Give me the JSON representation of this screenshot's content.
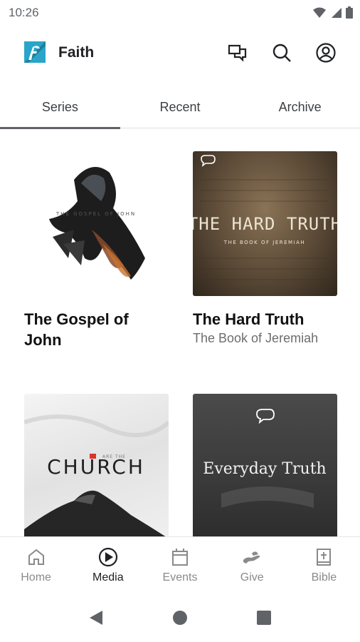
{
  "status": {
    "time": "10:26"
  },
  "app": {
    "title": "Faith"
  },
  "tabs": [
    {
      "label": "Series",
      "active": true
    },
    {
      "label": "Recent",
      "active": false
    },
    {
      "label": "Archive",
      "active": false
    }
  ],
  "series": [
    {
      "title": "The Gospel of John",
      "subtitle": "",
      "art_title": "THE GOSPEL OF JOHN"
    },
    {
      "title": "The Hard Truth",
      "subtitle": "The Book of Jeremiah",
      "art_title": "THE HARD TRUTH",
      "art_subtitle": "THE BOOK OF JEREMIAH"
    },
    {
      "title": "",
      "subtitle": "",
      "art_title": "CHURCH",
      "art_kicker": "ARE THE"
    },
    {
      "title": "",
      "subtitle": "",
      "art_title": "Everyday Truth"
    }
  ],
  "bottom_nav": [
    {
      "label": "Home",
      "icon": "home-icon",
      "active": false
    },
    {
      "label": "Media",
      "icon": "play-circle-icon",
      "active": true
    },
    {
      "label": "Events",
      "icon": "calendar-icon",
      "active": false
    },
    {
      "label": "Give",
      "icon": "give-hand-icon",
      "active": false
    },
    {
      "label": "Bible",
      "icon": "bible-icon",
      "active": false
    }
  ],
  "colors": {
    "brand": "#2aa5c9",
    "active_tab": "#5f6368",
    "muted": "#8a8a8a"
  }
}
